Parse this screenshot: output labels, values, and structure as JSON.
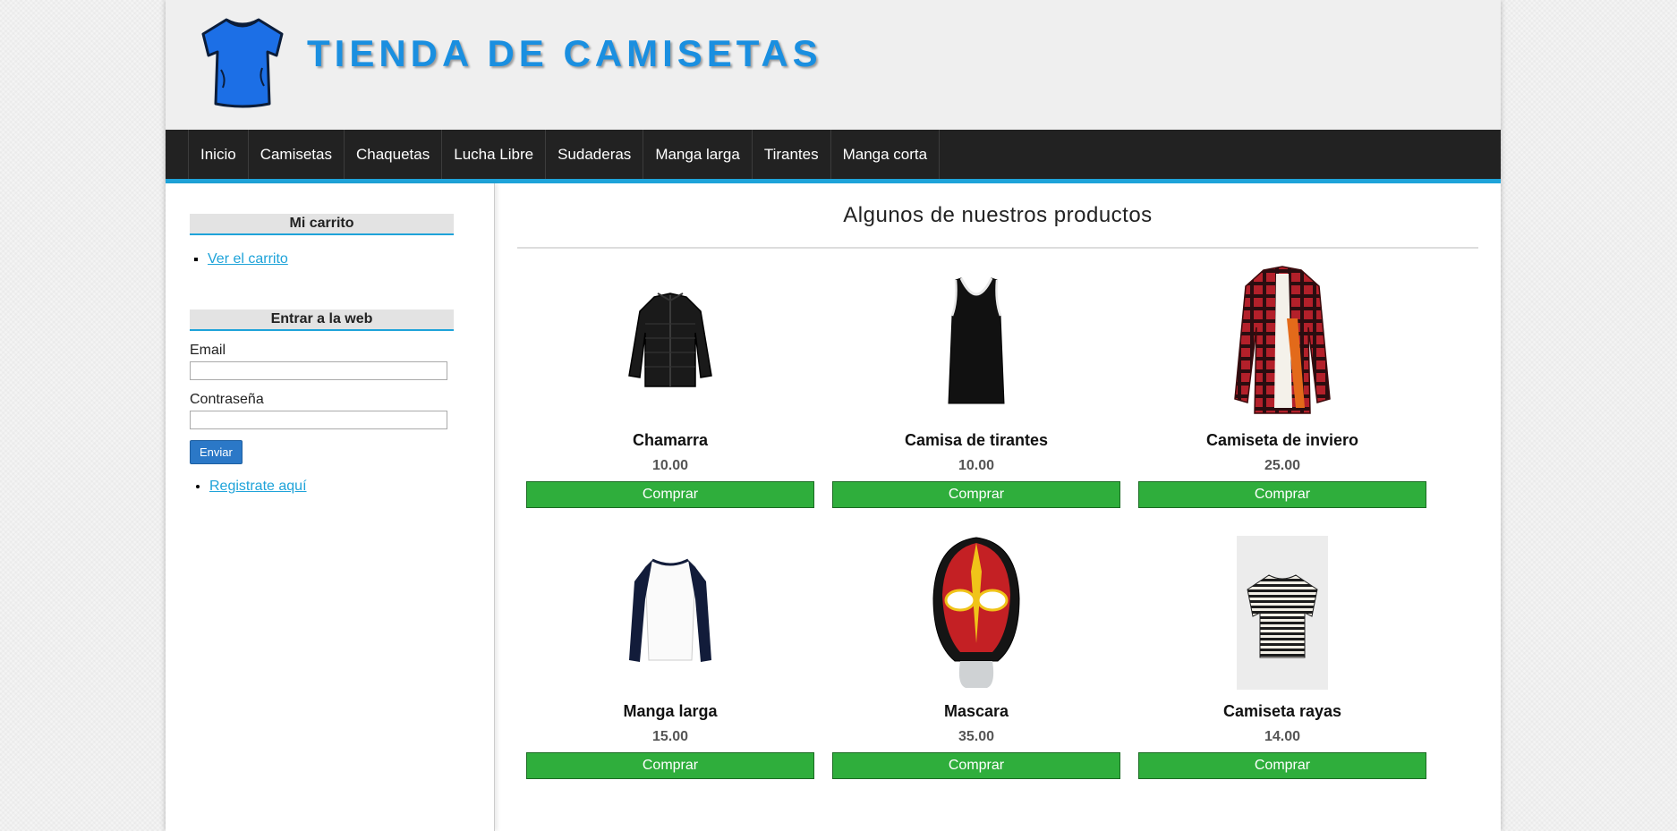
{
  "header": {
    "title": "TIENDA DE CAMISETAS",
    "logo_icon": "tshirt-icon",
    "brand_color": "#1a8fe0"
  },
  "nav": {
    "items": [
      "Inicio",
      "Camisetas",
      "Chaquetas",
      "Lucha Libre",
      "Sudaderas",
      "Manga larga",
      "Tirantes",
      "Manga corta"
    ]
  },
  "sidebar": {
    "cart": {
      "heading": "Mi carrito",
      "link": "Ver el carrito"
    },
    "login": {
      "heading": "Entrar a la web",
      "email_label": "Email",
      "password_label": "Contraseña",
      "submit_label": "Enviar",
      "register_link": "Registrate aquí"
    }
  },
  "main": {
    "title": "Algunos de nuestros productos",
    "products": [
      {
        "name": "Chamarra",
        "price": "10.00",
        "button": "Comprar",
        "icon": "jacket-icon"
      },
      {
        "name": "Camisa de tirantes",
        "price": "10.00",
        "button": "Comprar",
        "icon": "tank-top-icon"
      },
      {
        "name": "Camiseta de inviero",
        "price": "25.00",
        "button": "Comprar",
        "icon": "plaid-shirt-icon"
      },
      {
        "name": "Manga larga",
        "price": "15.00",
        "button": "Comprar",
        "icon": "raglan-shirt-icon"
      },
      {
        "name": "Mascara",
        "price": "35.00",
        "button": "Comprar",
        "icon": "wrestling-mask-icon"
      },
      {
        "name": "Camiseta rayas",
        "price": "14.00",
        "button": "Comprar",
        "icon": "striped-tshirt-icon"
      }
    ]
  },
  "colors": {
    "nav_bg": "#222222",
    "accent": "#1ea3d9",
    "buy_button": "#2fae3c",
    "submit_button": "#2b78c7"
  }
}
